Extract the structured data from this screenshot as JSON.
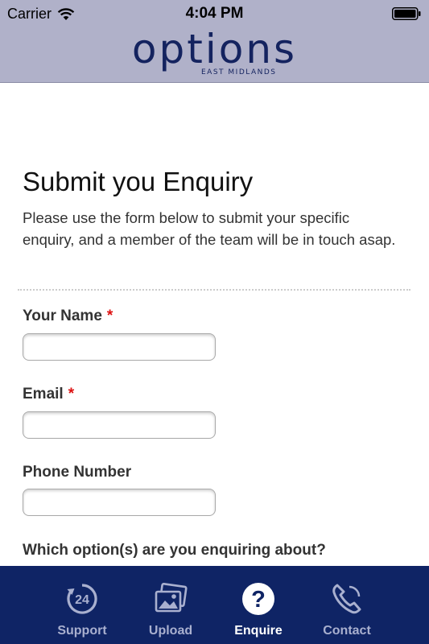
{
  "status_bar": {
    "carrier": "Carrier",
    "time": "4:04 PM",
    "wifi_icon": "wifi-icon",
    "battery_icon": "battery-icon"
  },
  "header": {
    "logo_main": "options",
    "logo_sub": "EAST MIDLANDS",
    "background_color": "#b0b1c9",
    "brand_color": "#14235f"
  },
  "page": {
    "title": "Submit you Enquiry",
    "intro": "Please use the form below to submit your specific enquiry, and a member of the team will be in touch asap."
  },
  "form": {
    "name_label": "Your Name",
    "name_required": "*",
    "name_value": "",
    "email_label": "Email",
    "email_required": "*",
    "email_value": "",
    "phone_label": "Phone Number",
    "phone_value": "",
    "options_label": "Which option(s) are you enquiring about?",
    "required_color": "#dd1111"
  },
  "tabbar": {
    "background_color": "#0f2465",
    "active_tab": "Enquire",
    "tabs": [
      {
        "label": "Support",
        "icon": "support-24-icon"
      },
      {
        "label": "Upload",
        "icon": "photos-icon"
      },
      {
        "label": "Enquire",
        "icon": "question-icon"
      },
      {
        "label": "Contact",
        "icon": "phone-icon"
      }
    ]
  }
}
